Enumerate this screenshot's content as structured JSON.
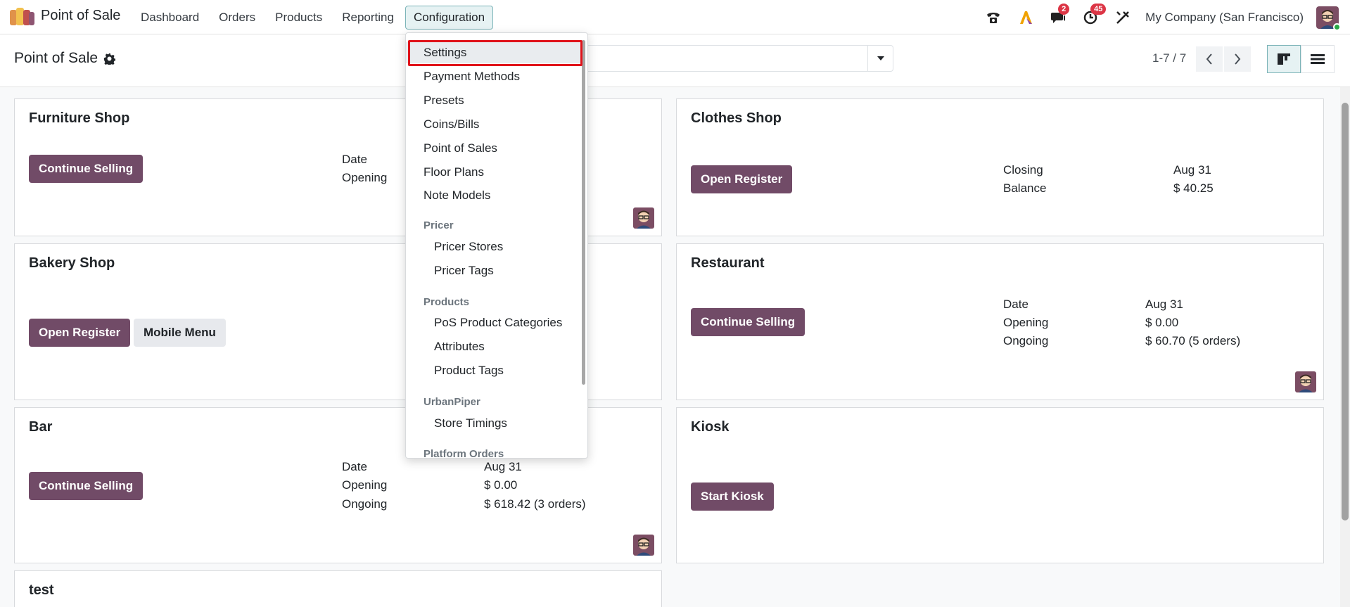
{
  "app": {
    "title": "Point of Sale"
  },
  "nav": {
    "items": [
      "Dashboard",
      "Orders",
      "Products",
      "Reporting",
      "Configuration"
    ],
    "active": "Configuration"
  },
  "systray": {
    "messages_count": "2",
    "activities_count": "45",
    "company": "My Company (San Francisco)"
  },
  "control_panel": {
    "breadcrumb": "Point of Sale",
    "pager": "1-7 / 7"
  },
  "dropdown": {
    "settings": "Settings",
    "payment_methods": "Payment Methods",
    "presets": "Presets",
    "coins_bills": "Coins/Bills",
    "point_of_sales": "Point of Sales",
    "floor_plans": "Floor Plans",
    "note_models": "Note Models",
    "pricer_header": "Pricer",
    "pricer_stores": "Pricer Stores",
    "pricer_tags": "Pricer Tags",
    "products_header": "Products",
    "pos_product_categories": "PoS Product Categories",
    "attributes": "Attributes",
    "product_tags": "Product Tags",
    "urbanpiper_header": "UrbanPiper",
    "store_timings": "Store Timings",
    "platform_orders_header": "Platform Orders"
  },
  "cards": {
    "furniture": {
      "title": "Furniture Shop",
      "button": "Continue Selling",
      "label_date": "Date",
      "label_opening": "Opening"
    },
    "clothes": {
      "title": "Clothes Shop",
      "button": "Open Register",
      "label_closing": "Closing",
      "value_closing": "Aug 31",
      "label_balance": "Balance",
      "value_balance": "$ 40.25"
    },
    "bakery": {
      "title": "Bakery Shop",
      "button": "Open Register",
      "button2": "Mobile Menu"
    },
    "restaurant": {
      "title": "Restaurant",
      "button": "Continue Selling",
      "label_date": "Date",
      "value_date": "Aug 31",
      "label_opening": "Opening",
      "value_opening": "$ 0.00",
      "label_ongoing": "Ongoing",
      "value_ongoing": "$ 60.70 (5 orders)"
    },
    "bar": {
      "title": "Bar",
      "button": "Continue Selling",
      "label_date": "Date",
      "value_date": "Aug 31",
      "label_opening": "Opening",
      "value_opening": "$ 0.00",
      "label_ongoing": "Ongoing",
      "value_ongoing": "$ 618.42 (3 orders)"
    },
    "kiosk": {
      "title": "Kiosk",
      "button": "Start Kiosk"
    },
    "test": {
      "title": "test"
    }
  },
  "colors": {
    "primary": "#714b67",
    "highlight_border": "#e0131a",
    "active_view": "#e6f2f3",
    "badge": "#dc3545"
  },
  "icons": [
    "app-logo-icon",
    "phone-icon",
    "ai-icon",
    "chat-icon",
    "clock-icon",
    "tools-icon",
    "gear-icon",
    "search-caret-icon",
    "chevron-left-icon",
    "chevron-right-icon",
    "kanban-view-icon",
    "list-view-icon"
  ]
}
